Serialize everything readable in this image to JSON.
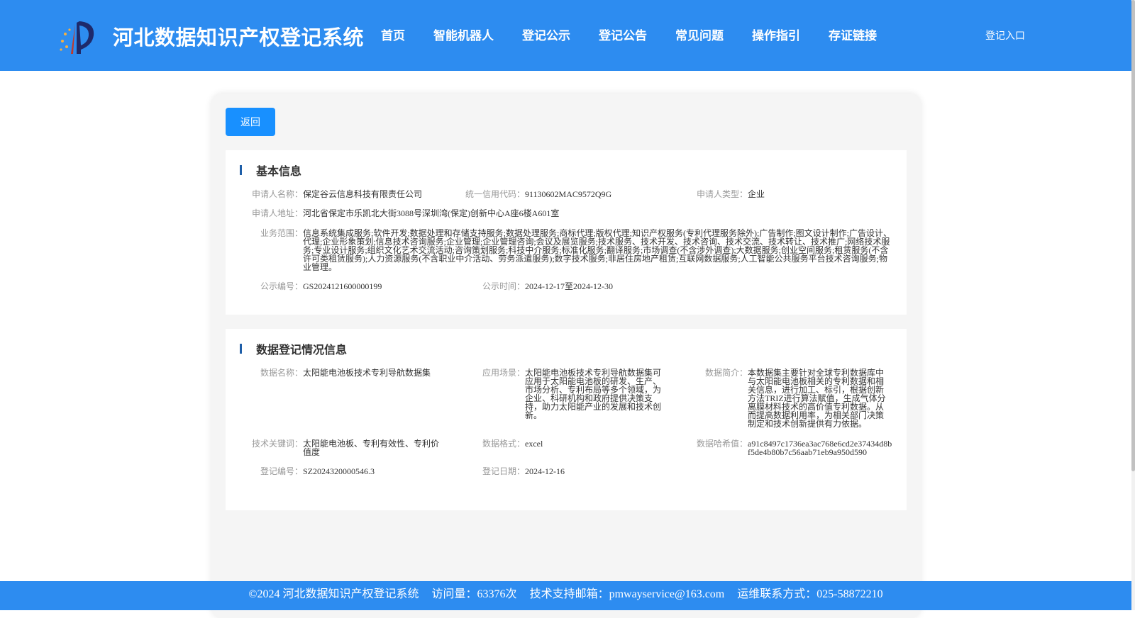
{
  "header": {
    "site_title": "河北数据知识产权登记系统",
    "nav": [
      "首页",
      "智能机器人",
      "登记公示",
      "登记公告",
      "常见问题",
      "操作指引",
      "存证链接"
    ],
    "login_label": "登记入口"
  },
  "back_label": "返回",
  "basic_info": {
    "title": "基本信息",
    "applicant_name": {
      "label": "申请人名称：",
      "value": "保定谷云信息科技有限责任公司"
    },
    "credit_code": {
      "label": "统一信用代码：",
      "value": "91130602MAC9572Q9G"
    },
    "applicant_type": {
      "label": "申请人类型：",
      "value": "企业"
    },
    "address": {
      "label": "申请人地址：",
      "value": "河北省保定市乐凯北大街3088号深圳湾(保定)创新中心A座6楼A601室"
    },
    "business_scope": {
      "label": "业务范围：",
      "value": "信息系统集成服务;软件开发;数据处理和存储支持服务;数据处理服务;商标代理;版权代理;知识产权服务(专利代理服务除外);广告制作;图文设计制作;广告设计、代理;企业形象策划;信息技术咨询服务;企业管理;企业管理咨询;会议及展览服务;技术服务、技术开发、技术咨询、技术交流、技术转让、技术推广;网络技术服务;专业设计服务;组织文化艺术交流活动;咨询策划服务;科技中介服务;标准化服务;翻译服务;市场调查(不含涉外调查);大数据服务;创业空间服务;租赁服务(不含许可类租赁服务);人力资源服务(不含职业中介活动、劳务派遣服务);数字技术服务;非居住房地产租赁;互联网数据服务;人工智能公共服务平台技术咨询服务;物业管理。"
    },
    "notice_no": {
      "label": "公示编号：",
      "value": "GS2024121600000199"
    },
    "notice_time": {
      "label": "公示时间：",
      "value": "2024-12-17至2024-12-30"
    }
  },
  "data_info": {
    "title": "数据登记情况信息",
    "data_name": {
      "label": "数据名称：",
      "value": "太阳能电池板技术专利导航数据集"
    },
    "scenario": {
      "label": "应用场景：",
      "value": "太阳能电池板技术专利导航数据集可应用于太阳能电池板的研发、生产、市场分析、专利布局等多个领域，为企业、科研机构和政府提供决策支持，助力太阳能产业的发展和技术创新。"
    },
    "summary": {
      "label": "数据简介：",
      "value": "本数据集主要针对全球专利数据库中与太阳能电池板相关的专利数据和相关信息，进行加工、标引，根据创新方法TRIZ进行算法赋值，生成气体分离膜材料技术的高价值专利数据。从而提高数据利用率，为相关部门决策制定和技术创新提供有力依据。"
    },
    "keywords": {
      "label": "技术关键词：",
      "value": "太阳能电池板、专利有效性、专利价值度"
    },
    "format": {
      "label": "数据格式：",
      "value": "excel"
    },
    "hash": {
      "label": "数据哈希值：",
      "value": "a91c8497c1736ea3ac768e6cd2e37434d8bf5de4b80b7c56aab71eb9a950d590"
    },
    "reg_no": {
      "label": "登记编号：",
      "value": "SZ2024320000546.3"
    },
    "reg_date": {
      "label": "登记日期：",
      "value": "2024-12-16"
    }
  },
  "footer": {
    "copyright": "©2024 河北数据知识产权登记系统",
    "visits": "访问量：63376次",
    "email": "技术支持邮箱：pmwayservice@163.com",
    "phone": "运维联系方式：025-58872210"
  }
}
